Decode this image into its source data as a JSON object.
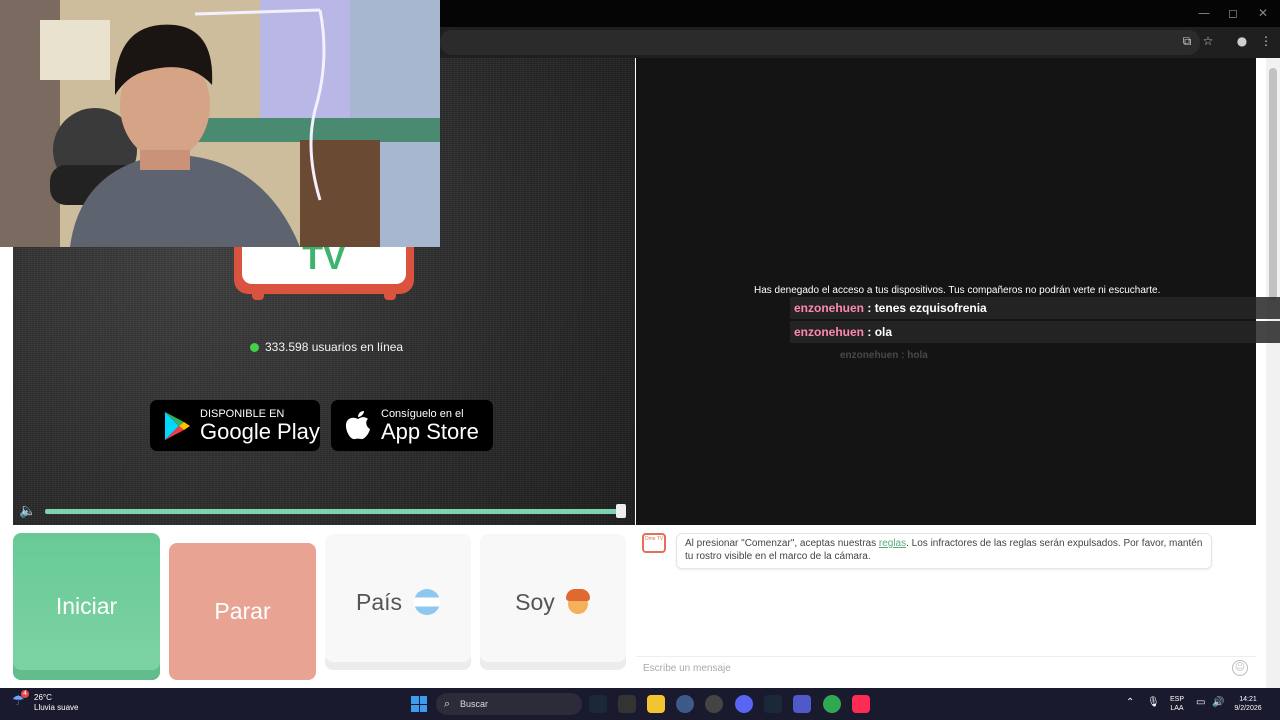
{
  "window": {
    "minimize": "—",
    "maximize": "◻",
    "close": "✕"
  },
  "toolbar": {
    "install_icon": "install-app-icon",
    "star_icon": "bookmark-star-icon",
    "profile_icon": "profile-icon",
    "menu_icon": "menu-icon"
  },
  "left_panel": {
    "logo_text": "TV",
    "online_count": "333.598 usuarios en línea",
    "google_play": {
      "small": "DISPONIBLE EN",
      "big": "Google Play"
    },
    "app_store": {
      "small": "Consíguelo en el",
      "big": "App Store"
    }
  },
  "right_panel": {
    "system_message": "Has denegado el acceso a tus dispositivos. Tus compañeros no podrán verte ni escucharte.",
    "chat": [
      {
        "user": "enzonehuen",
        "text": ": tenes ezquisofrenia"
      },
      {
        "user": "enzonehuen",
        "text": ": ola"
      },
      {
        "user": "enzonehuen",
        "text": ": hola"
      }
    ]
  },
  "buttons": {
    "start": "Iniciar",
    "stop": "Parar",
    "country": "País",
    "country_flag": "🇦🇷",
    "gender": "Soy",
    "gender_emoji": "🧒"
  },
  "rules": {
    "avatar": "Ome TV",
    "prefix": "Al presionar \"Comenzar\", aceptas nuestras ",
    "link": "reglas",
    "suffix": ". Los infractores de las reglas serán expulsados. Por favor, mantén tu rostro visible en el marco de la cámara."
  },
  "message_input": {
    "placeholder": "Escribe un mensaje"
  },
  "taskbar": {
    "temperature": "26°C",
    "weather": "Lluvia suave",
    "weather_badge": "4",
    "search_placeholder": "Buscar",
    "language": "ESP",
    "layout": "LAA",
    "time": "14:21",
    "date": "9/2/2026"
  },
  "colors": {
    "start_green": "#68c997",
    "stop_salmon": "#e8a393",
    "username_pink": "#ff88b4",
    "online_green": "#43d04a",
    "logo_red": "#d9533f",
    "logo_green": "#3db46d"
  }
}
